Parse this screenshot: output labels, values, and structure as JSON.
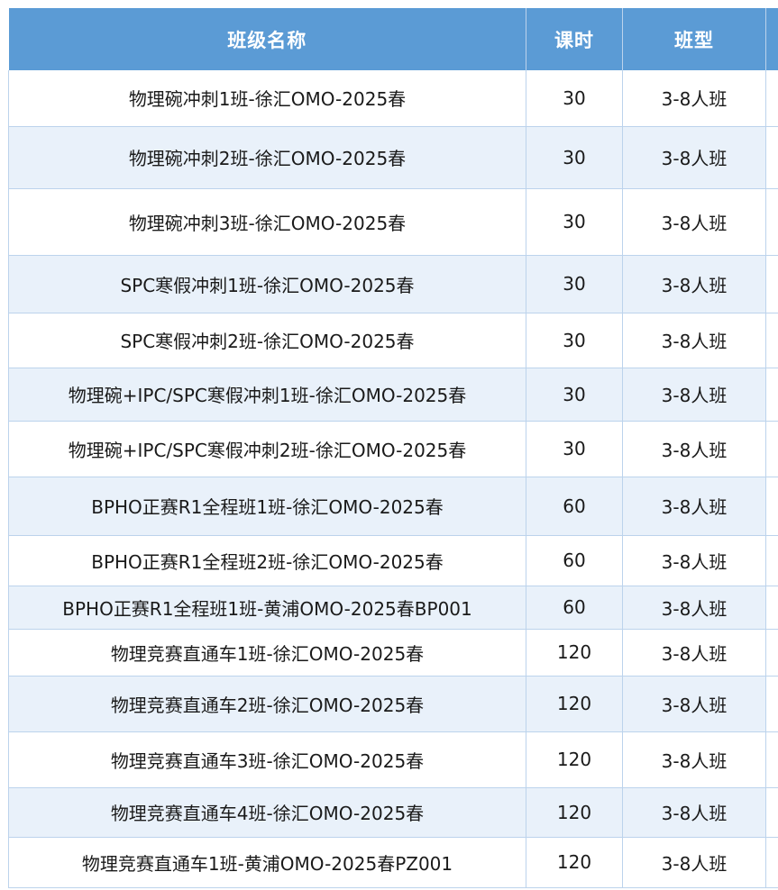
{
  "table": {
    "headers": {
      "name": "班级名称",
      "hours": "课时",
      "type": "班型"
    },
    "rows": [
      {
        "name": "物理碗冲刺1班-徐汇OMO-2025春",
        "hours": "30",
        "type": "3-8人班"
      },
      {
        "name": "物理碗冲刺2班-徐汇OMO-2025春",
        "hours": "30",
        "type": "3-8人班"
      },
      {
        "name": "物理碗冲刺3班-徐汇OMO-2025春",
        "hours": "30",
        "type": "3-8人班"
      },
      {
        "name": "SPC寒假冲刺1班-徐汇OMO-2025春",
        "hours": "30",
        "type": "3-8人班"
      },
      {
        "name": "SPC寒假冲刺2班-徐汇OMO-2025春",
        "hours": "30",
        "type": "3-8人班"
      },
      {
        "name": "物理碗+IPC/SPC寒假冲刺1班-徐汇OMO-2025春",
        "hours": "30",
        "type": "3-8人班"
      },
      {
        "name": "物理碗+IPC/SPC寒假冲刺2班-徐汇OMO-2025春",
        "hours": "30",
        "type": "3-8人班"
      },
      {
        "name": "BPHO正赛R1全程班1班-徐汇OMO-2025春",
        "hours": "60",
        "type": "3-8人班"
      },
      {
        "name": "BPHO正赛R1全程班2班-徐汇OMO-2025春",
        "hours": "60",
        "type": "3-8人班"
      },
      {
        "name": "BPHO正赛R1全程班1班-黄浦OMO-2025春BP001",
        "hours": "60",
        "type": "3-8人班"
      },
      {
        "name": "物理竞赛直通车1班-徐汇OMO-2025春",
        "hours": "120",
        "type": "3-8人班"
      },
      {
        "name": "物理竞赛直通车2班-徐汇OMO-2025春",
        "hours": "120",
        "type": "3-8人班"
      },
      {
        "name": "物理竞赛直通车3班-徐汇OMO-2025春",
        "hours": "120",
        "type": "3-8人班"
      },
      {
        "name": "物理竞赛直通车4班-徐汇OMO-2025春",
        "hours": "120",
        "type": "3-8人班"
      },
      {
        "name": "物理竞赛直通车1班-黄浦OMO-2025春PZ001",
        "hours": "120",
        "type": "3-8人班"
      }
    ]
  },
  "colors": {
    "header_bg": "#5b9bd5",
    "row_stripe": "#e9f1fa",
    "grid": "#bcd3ec"
  }
}
